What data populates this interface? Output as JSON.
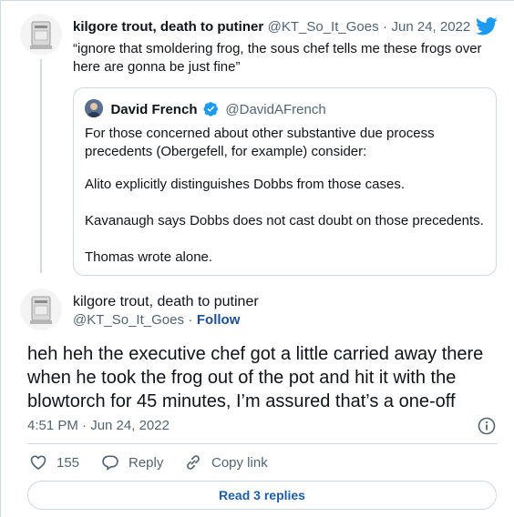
{
  "tweet1": {
    "name": "kilgore trout, death to putiner",
    "handle": "@KT_So_It_Goes",
    "dot": "·",
    "date": "Jun 24, 2022",
    "text_line1": "“ignore that smoldering frog, the sous chef tells me these frogs over",
    "text_line2": "here are gonna be just fine”"
  },
  "quote": {
    "name": "David French",
    "handle": "@DavidAFrench",
    "line1": "For those concerned about other substantive due process",
    "line2": "precedents (Obergefell, for example) consider:",
    "line3": "Alito explicitly distinguishes Dobbs from those cases.",
    "line4": "Kavanaugh says Dobbs does not cast doubt on those precedents.",
    "line5": "Thomas wrote alone."
  },
  "tweet2": {
    "name": "kilgore trout, death to putiner",
    "handle": "@KT_So_It_Goes",
    "dot": "·",
    "follow_label": "Follow",
    "text_line1": "heh heh the executive chef got a little carried away there",
    "text_line2": "when he took the frog out of the pot and hit it with the",
    "text_line3": "blowtorch for 45 minutes, I’m assured that’s a one-off",
    "timestamp": "4:51 PM · Jun 24, 2022"
  },
  "actions": {
    "like_count": "155",
    "reply_label": "Reply",
    "copy_link_label": "Copy link"
  },
  "read_replies_label": "Read 3 replies",
  "colors": {
    "twitter_blue": "#1d9bf0",
    "follow_blue": "#1d4f91",
    "muted": "#536471",
    "border": "#cfd9de"
  },
  "icons": [
    "twitter-bird-icon",
    "verified-badge-icon",
    "info-icon",
    "heart-icon",
    "reply-icon",
    "link-icon"
  ]
}
